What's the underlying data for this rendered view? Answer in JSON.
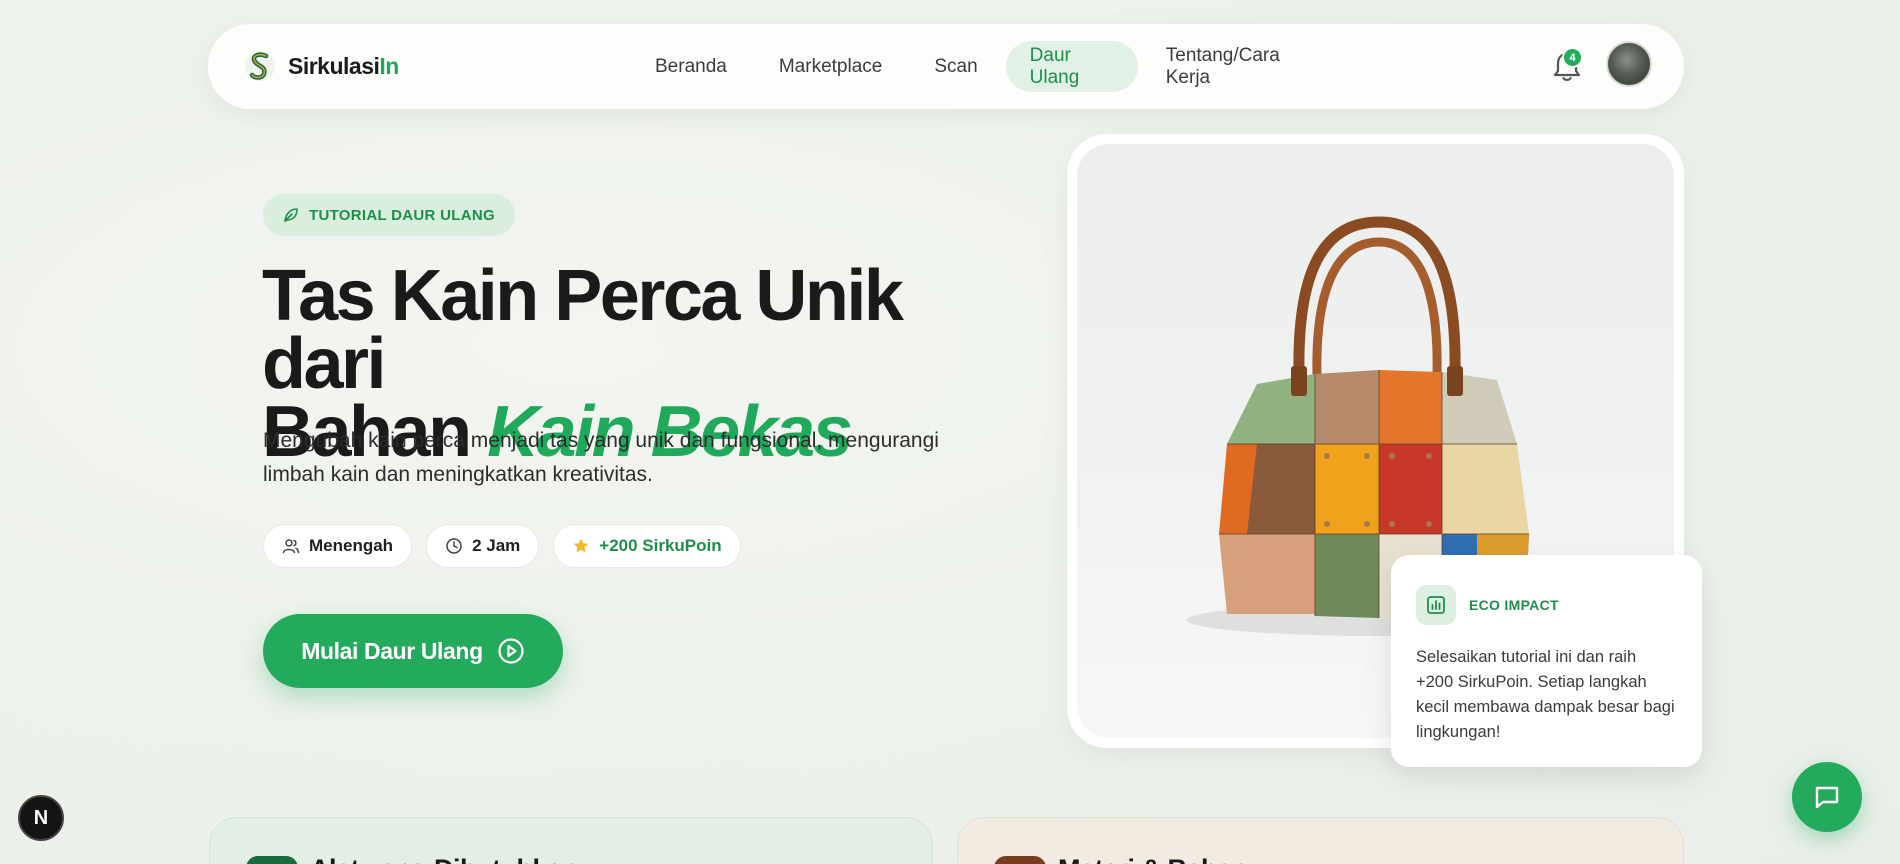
{
  "colors": {
    "brand_green": "#23aa5d",
    "brand_green_dark": "#1d8e4c",
    "tag_bg": "#d9eedd",
    "nav_active_bg": "#e2f1e5",
    "star": "#f2b632"
  },
  "navbar": {
    "brand": {
      "name_main": "Sirkulasi",
      "name_accent": "In",
      "logo_icon": "sirkulasiin-s-logo"
    },
    "links": [
      {
        "label": "Beranda",
        "active": false
      },
      {
        "label": "Marketplace",
        "active": false
      },
      {
        "label": "Scan",
        "active": false
      },
      {
        "label": "Daur Ulang",
        "active": true
      },
      {
        "label": "Tentang/Cara Kerja",
        "active": false
      }
    ],
    "notifications": {
      "icon": "bell-icon",
      "count": "4"
    },
    "avatar": {
      "icon": "user-avatar"
    }
  },
  "hero": {
    "tag": {
      "icon": "leaf-icon",
      "label": "TUTORIAL DAUR ULANG"
    },
    "title_line1": "Tas Kain Perca Unik dari",
    "title_line2_plain": "Bahan",
    "title_line2_accent": "Kain Bekas",
    "description": "Mengubah kain perca menjadi tas yang unik dan fungsional, mengurangi limbah kain dan meningkatkan kreativitas.",
    "chips": [
      {
        "icon": "users-icon",
        "label": "Menengah"
      },
      {
        "icon": "clock-icon",
        "label": "2 Jam"
      },
      {
        "icon": "star-icon",
        "label": "+200 SirkuPoin"
      }
    ],
    "cta": {
      "label": "Mulai Daur Ulang",
      "icon": "play-circle-icon"
    }
  },
  "eco_impact": {
    "icon": "bar-chart-icon",
    "title": "ECO IMPACT",
    "text": "Selesaikan tutorial ini dan raih +200 SirkuPoin. Setiap langkah kecil membawa dampak besar bagi lingkungan!"
  },
  "bottom_cards": [
    {
      "title": "Alat yang Dibutuhkan"
    },
    {
      "title": "Materi & Bahan"
    }
  ],
  "floating": {
    "next_badge": "N",
    "chat_icon": "chat-bubble-icon"
  }
}
